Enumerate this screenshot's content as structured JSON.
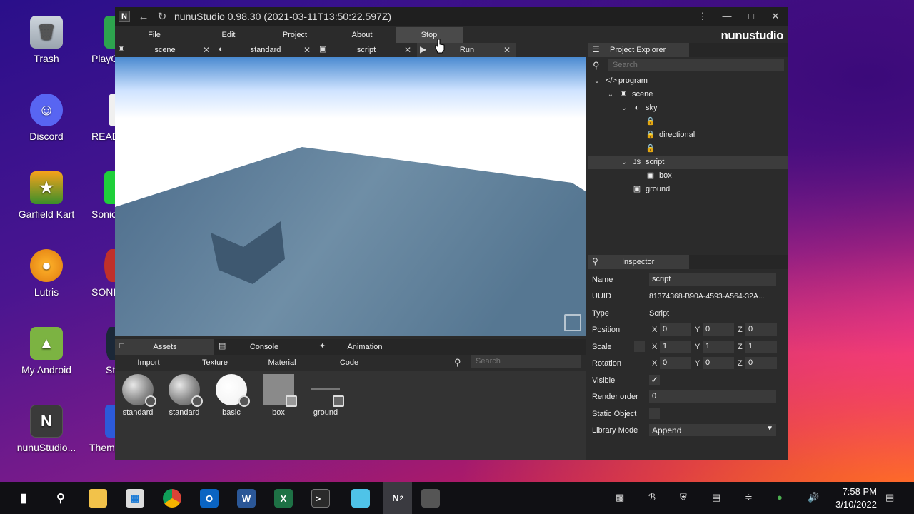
{
  "desktop": {
    "icons": [
      {
        "label": "Trash",
        "icon": "trash-icon"
      },
      {
        "label": "Discord",
        "icon": "discord-icon"
      },
      {
        "label": "Garfield Kart",
        "icon": "garfield-kart-icon"
      },
      {
        "label": "Lutris",
        "icon": "lutris-icon"
      },
      {
        "label": "My Android",
        "icon": "android-icon"
      },
      {
        "label": "nunuStudio...",
        "icon": "nunustudio-icon"
      }
    ],
    "partial_icons": [
      "PlayO",
      "READ",
      "Sonic",
      "SONI",
      "St",
      "Them"
    ]
  },
  "window": {
    "title": "nunuStudio 0.98.30 (2021-03-11T13:50:22.597Z)",
    "logo_letter": "N",
    "brand": "nunustudio",
    "menu": [
      "File",
      "Edit",
      "Project",
      "About",
      "Stop"
    ],
    "active_menu": "Stop"
  },
  "tabs": [
    {
      "label": "scene",
      "icon": "scene-icon"
    },
    {
      "label": "standard",
      "icon": "material-icon"
    },
    {
      "label": "script",
      "icon": "monitor-icon"
    },
    {
      "label": "Run",
      "icon": "play-icon"
    }
  ],
  "assets": {
    "tabs": [
      "Assets",
      "Console",
      "Animation"
    ],
    "menu": [
      "Import",
      "Texture",
      "Material",
      "Code"
    ],
    "search_placeholder": "Search",
    "items": [
      {
        "label": "standard",
        "kind": "sphere-grey"
      },
      {
        "label": "standard",
        "kind": "sphere-grey"
      },
      {
        "label": "basic",
        "kind": "sphere-white"
      },
      {
        "label": "box",
        "kind": "box"
      },
      {
        "label": "ground",
        "kind": "plane"
      }
    ]
  },
  "explorer": {
    "title": "Project Explorer",
    "search_placeholder": "Search",
    "tree": [
      {
        "label": "program",
        "icon": "code-icon",
        "depth": 0,
        "expanded": true
      },
      {
        "label": "scene",
        "icon": "scene-icon",
        "depth": 1,
        "expanded": true
      },
      {
        "label": "sky",
        "icon": "sky-icon",
        "depth": 2,
        "expanded": true
      },
      {
        "label": "",
        "icon": "lock-icon",
        "depth": 3
      },
      {
        "label": "directional",
        "icon": "lock-icon",
        "depth": 3
      },
      {
        "label": "",
        "icon": "lock-icon",
        "depth": 3
      },
      {
        "label": "script",
        "icon": "script-icon",
        "depth": 2,
        "expanded": true,
        "selected": true
      },
      {
        "label": "box",
        "icon": "cube-icon",
        "depth": 3
      },
      {
        "label": "ground",
        "icon": "cube-icon",
        "depth": 2
      }
    ]
  },
  "inspector": {
    "title": "Inspector",
    "name_label": "Name",
    "name_value": "script",
    "uuid_label": "UUID",
    "uuid_value": "81374368-B90A-4593-A564-32A...",
    "type_label": "Type",
    "type_value": "Script",
    "position_label": "Position",
    "position": {
      "x": "0",
      "y": "0",
      "z": "0"
    },
    "scale_label": "Scale",
    "scale": {
      "x": "1",
      "y": "1",
      "z": "1"
    },
    "rotation_label": "Rotation",
    "rotation": {
      "x": "0",
      "y": "0",
      "z": "0"
    },
    "visible_label": "Visible",
    "visible": true,
    "render_order_label": "Render order",
    "render_order": "0",
    "static_label": "Static Object",
    "static": false,
    "library_label": "Library Mode",
    "library_value": "Append"
  },
  "taskbar": {
    "time": "7:58 PM",
    "date": "3/10/2022",
    "nunu_badge": "2"
  }
}
